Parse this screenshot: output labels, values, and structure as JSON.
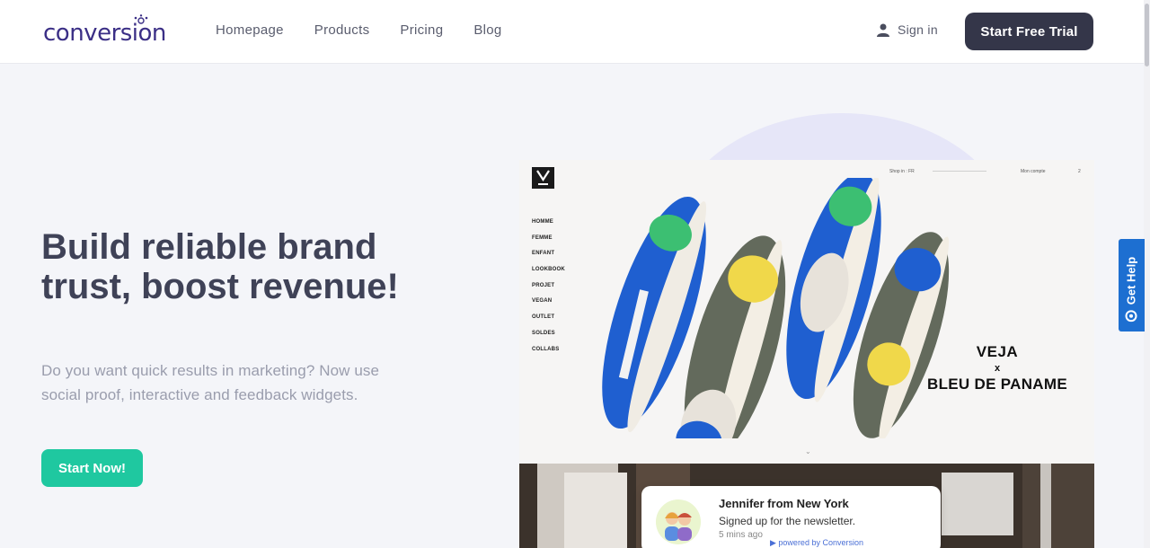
{
  "header": {
    "logo_text": "conversion",
    "nav": [
      "Homepage",
      "Products",
      "Pricing",
      "Blog"
    ],
    "sign_in": "Sign in",
    "cta": "Start Free Trial"
  },
  "hero": {
    "headline": "Build reliable brand trust, boost revenue!",
    "subtext": "Do you want quick results in marketing? Now use social proof, interactive and feedback widgets.",
    "cta": "Start Now!"
  },
  "mockup": {
    "brand_logo": "V",
    "brand_logo_sub": "VEJA",
    "menu": [
      "HOMME",
      "FEMME",
      "ENFANT",
      "LOOKBOOK",
      "PROJET",
      "VEGAN",
      "OUTLET",
      "SOLDES",
      "COLLABS"
    ],
    "top_links": [
      "Shop in : FR",
      "Mon compte",
      "2"
    ],
    "collab_line1": "VEJA",
    "collab_x": "x",
    "collab_line2": "BLEU DE PANAME"
  },
  "notification": {
    "name": "Jennifer from New York",
    "message": "Signed up for the newsletter.",
    "time": "5 mins ago",
    "powered_by": "powered by Conversion"
  },
  "help_tab": {
    "label": "Get Help",
    "icon": "help-circle-icon"
  },
  "colors": {
    "primary_dark": "#343649",
    "accent_green": "#1fc8a0",
    "help_blue": "#1d6fd1",
    "logo_purple": "#3b2f86"
  }
}
